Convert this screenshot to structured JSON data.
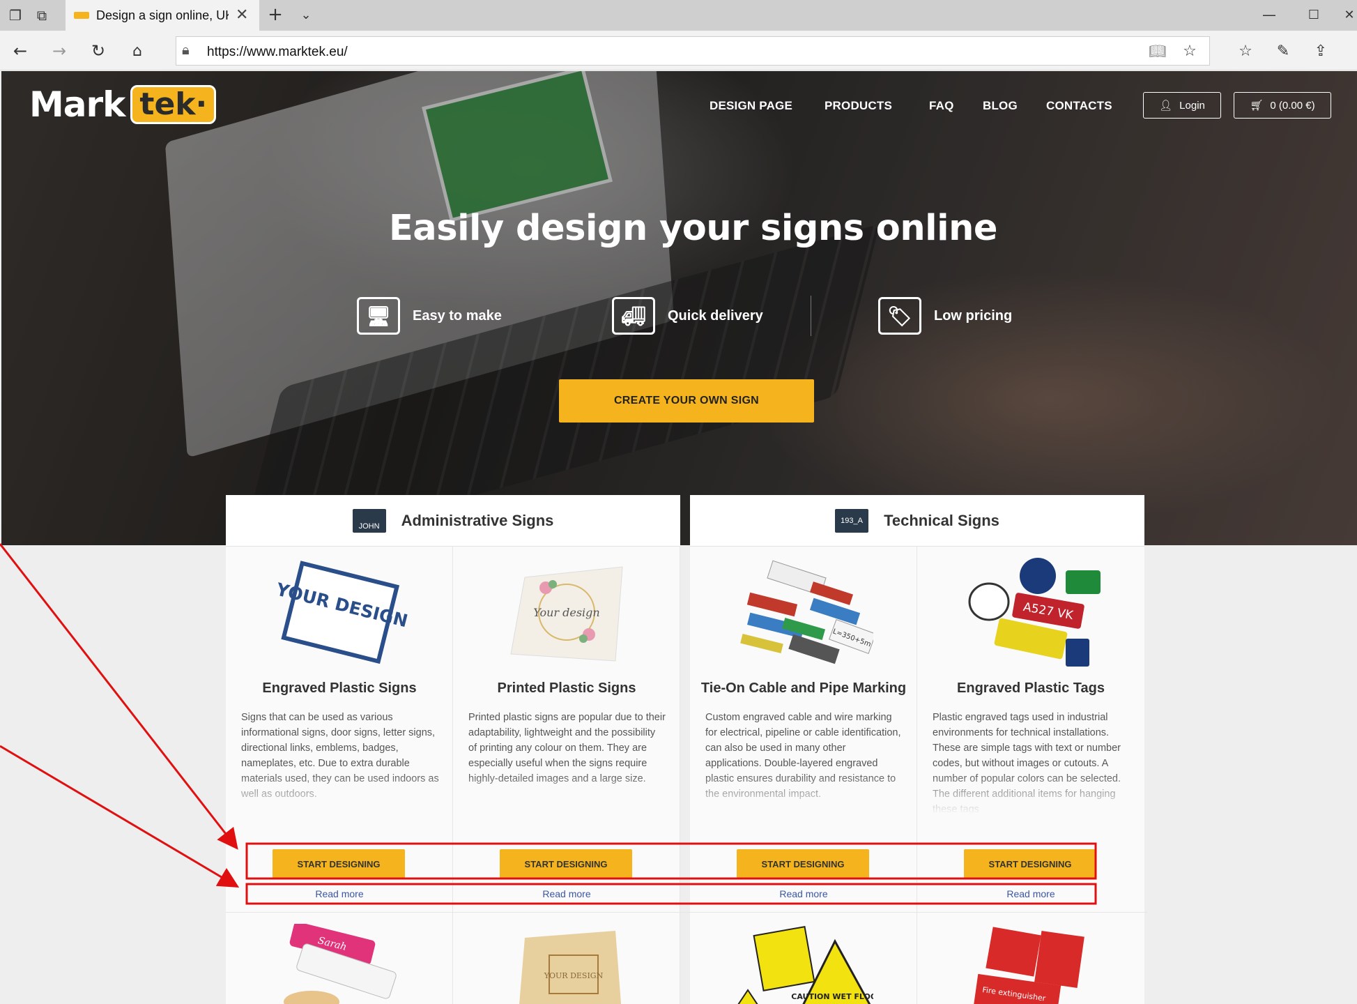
{
  "browser": {
    "tab_title": "Design a sign online, UK",
    "url": "https://www.marktek.eu/"
  },
  "site": {
    "logo": {
      "mark": "Mark",
      "tek": "tek·"
    },
    "nav": [
      "DESIGN PAGE",
      "PRODUCTS",
      "FAQ",
      "BLOG",
      "CONTACTS"
    ],
    "login_label": "Login",
    "cart_label": "0 (0.00 €)",
    "hero_title": "Easily design your signs online",
    "features": [
      "Easy to make",
      "Quick delivery",
      "Low pricing"
    ],
    "cta_label": "CREATE YOUR OWN SIGN",
    "categories": [
      {
        "title": "Administrative Signs",
        "icon_text": "JOHN"
      },
      {
        "title": "Technical Signs",
        "icon_text": "193_A"
      }
    ],
    "products": [
      {
        "name": "Engraved Plastic Signs",
        "desc": "Signs that can be used as various informational signs, door signs, letter signs, directional links, emblems, badges, nameplates, etc. Due to extra durable materials used, they can be used indoors as well as outdoors.",
        "thumb_text": "YOUR DESIGN"
      },
      {
        "name": "Printed Plastic Signs",
        "desc": "Printed plastic signs are popular due to their adaptability, lightweight and the possibility of printing any colour on them. They are especially useful when the signs require highly-detailed images and a large size.",
        "thumb_text": "Your design"
      },
      {
        "name": "Tie-On Cable and Pipe Marking",
        "desc": "Custom engraved cable and wire marking for electrical, pipeline or cable identification, can also be used in many other applications. Double-layered engraved plastic ensures durability and resistance to the environmental impact.",
        "thumb_text": "L=350+5m"
      },
      {
        "name": "Engraved Plastic Tags",
        "desc": "Plastic engraved tags used in industrial environments for technical installations. These are simple tags with text or number codes, but without images or cutouts. A number of popular colors can be selected. The different additional items for hanging these tags",
        "thumb_text": "A527 VK"
      }
    ],
    "start_label": "START DESIGNING",
    "read_more_label": "Read more",
    "row2_thumbs": [
      "Sarah",
      "YOUR DESIGN",
      "CAUTION WET FLOOR",
      "Fire extinguisher"
    ]
  },
  "colors": {
    "accent": "#f5b41d",
    "annotation": "#e01010",
    "link": "#3a56a8"
  }
}
